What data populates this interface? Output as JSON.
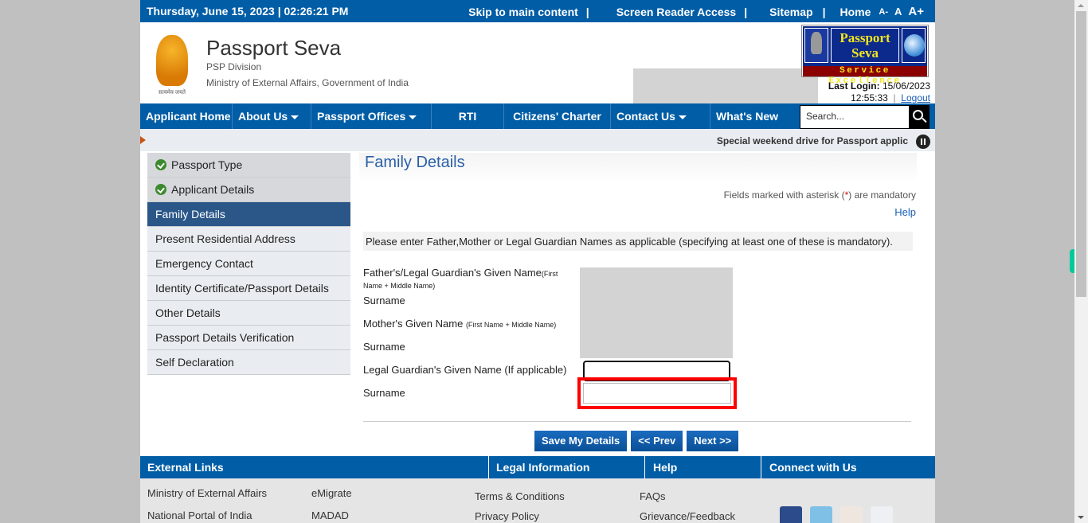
{
  "topbar": {
    "datetime": "Thursday,  June  15, 2023 | 02:26:21 PM",
    "skip_link": "Skip to main content",
    "screen_reader": "Screen Reader Access",
    "sitemap": "Sitemap",
    "home": "Home",
    "separator": "|",
    "font_small": "A-",
    "font_normal": "A",
    "font_large": "A+"
  },
  "header": {
    "emblem_motto": "सत्यमेव जयते",
    "title": "Passport Seva",
    "division": "PSP Division",
    "ministry": "Ministry of External Affairs, Government of India",
    "logo": {
      "line1": "Passport",
      "line2": "Seva",
      "tagline": "Service Excellence"
    },
    "last_login_label": "Last Login:",
    "last_login_date": "15/06/2023",
    "last_login_time": "12:55:33",
    "logout": "Logout"
  },
  "nav": {
    "items": [
      {
        "label": "Applicant Home",
        "dropdown": false
      },
      {
        "label": "About Us",
        "dropdown": true
      },
      {
        "label": "Passport Offices",
        "dropdown": true
      },
      {
        "label": "RTI",
        "dropdown": false
      },
      {
        "label": "Citizens' Charter",
        "dropdown": false
      },
      {
        "label": "Contact Us",
        "dropdown": true
      },
      {
        "label": "What's New",
        "dropdown": false
      }
    ],
    "search_placeholder": "Search..."
  },
  "ticker": {
    "message": "Special weekend drive for Passport applic"
  },
  "sidebar": {
    "items": [
      {
        "label": "Passport Type",
        "state": "done"
      },
      {
        "label": "Applicant Details",
        "state": "done"
      },
      {
        "label": "Family Details",
        "state": "active"
      },
      {
        "label": "Present Residential Address",
        "state": "pending"
      },
      {
        "label": "Emergency Contact",
        "state": "pending"
      },
      {
        "label": "Identity Certificate/Passport Details",
        "state": "pending"
      },
      {
        "label": "Other Details",
        "state": "pending"
      },
      {
        "label": "Passport Details Verification",
        "state": "pending"
      },
      {
        "label": "Self Declaration",
        "state": "pending"
      }
    ]
  },
  "main": {
    "title": "Family Details",
    "mandatory_prefix": "Fields marked with asterisk (",
    "mandatory_star": "*",
    "mandatory_suffix": ") are mandatory",
    "help": "Help",
    "instruction": "Please enter Father,Mother or Legal Guardian Names as applicable (specifying at least one of these is mandatory).",
    "fields": {
      "father_given": "Father's/Legal Guardian's Given Name",
      "father_given_hint1": "(First",
      "father_given_hint2": "Name + Middle Name)",
      "father_surname": "Surname",
      "mother_given": "Mother's Given Name",
      "mother_given_hint": "(First Name + Middle Name)",
      "mother_surname": "Surname",
      "guardian_given": "Legal Guardian's Given Name (If applicable)",
      "guardian_surname": "Surname",
      "guardian_given_value": "",
      "guardian_surname_value": ""
    },
    "buttons": {
      "save": "Save My Details",
      "prev": "<< Prev",
      "next": "Next >>"
    }
  },
  "footer": {
    "headers": {
      "external": "External Links",
      "legal": "Legal Information",
      "help": "Help",
      "connect": "Connect with Us"
    },
    "external_links": [
      "Ministry of External Affairs",
      "eMigrate",
      "National Portal of India",
      "MADAD"
    ],
    "legal_links": [
      "Terms & Conditions",
      "Privacy Policy"
    ],
    "help_links": [
      "FAQs",
      "Grievance/Feedback"
    ],
    "social": [
      "facebook",
      "twitter",
      "youtube",
      "flickr"
    ]
  },
  "colors": {
    "primary": "#005da6",
    "active_step": "#2a5788",
    "highlight": "#ff0000",
    "done_check": "#3d8a2e"
  }
}
